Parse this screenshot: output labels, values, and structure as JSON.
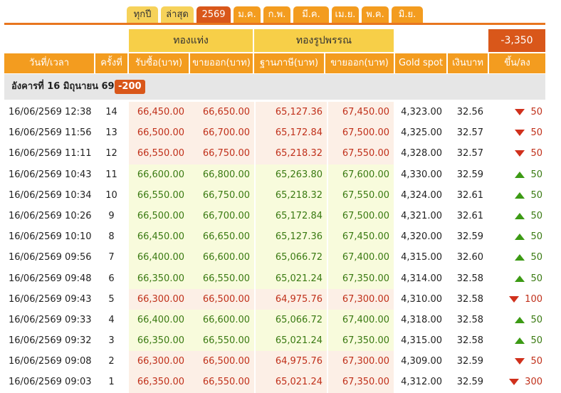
{
  "tabs": [
    {
      "label": "ทุกปี",
      "style": "light"
    },
    {
      "label": "ล่าสุด",
      "style": "light"
    },
    {
      "label": "2569",
      "style": "active"
    },
    {
      "label": "ม.ค.",
      "style": "normal"
    },
    {
      "label": "ก.พ.",
      "style": "normal"
    },
    {
      "label": "มี.ค.",
      "style": "normal"
    },
    {
      "label": "เม.ย.",
      "style": "normal"
    },
    {
      "label": "พ.ค.",
      "style": "normal"
    },
    {
      "label": "มิ.ย.",
      "style": "normal"
    }
  ],
  "header": {
    "group_bar": "ทองแท่ง",
    "group_ornament": "ทองรูปพรรณ",
    "total_change": "-3,350",
    "columns": {
      "datetime": "วันที่/เวลา",
      "round": "ครั้งที่",
      "bar_buy": "รับซื้อ(บาท)",
      "bar_sell": "ขายออก(บาท)",
      "orn_base": "ฐานภาษี(บาท)",
      "orn_sell": "ขายออก(บาท)",
      "gold_spot": "Gold spot",
      "thb": "เงินบาท",
      "change": "ขึ้น/ลง"
    }
  },
  "day": {
    "label": "อังคารที่ 16 มิถุนายน 69",
    "change": "-200"
  },
  "colors": {
    "tab_orange": "#f39c1f",
    "tab_active": "#d9571a",
    "group_yellow": "#f7cf48",
    "up_green": "#3c9a14",
    "down_red": "#d0301c"
  },
  "rows": [
    {
      "datetime": "16/06/2569 12:38",
      "round": "14",
      "bar_buy": "66,450.00",
      "bar_sell": "66,650.00",
      "orn_base": "65,127.36",
      "orn_sell": "67,450.00",
      "spot": "4,323.00",
      "thb": "32.56",
      "dir": "down",
      "change": "50"
    },
    {
      "datetime": "16/06/2569 11:56",
      "round": "13",
      "bar_buy": "66,500.00",
      "bar_sell": "66,700.00",
      "orn_base": "65,172.84",
      "orn_sell": "67,500.00",
      "spot": "4,325.00",
      "thb": "32.57",
      "dir": "down",
      "change": "50"
    },
    {
      "datetime": "16/06/2569 11:11",
      "round": "12",
      "bar_buy": "66,550.00",
      "bar_sell": "66,750.00",
      "orn_base": "65,218.32",
      "orn_sell": "67,550.00",
      "spot": "4,328.00",
      "thb": "32.57",
      "dir": "down",
      "change": "50"
    },
    {
      "datetime": "16/06/2569 10:43",
      "round": "11",
      "bar_buy": "66,600.00",
      "bar_sell": "66,800.00",
      "orn_base": "65,263.80",
      "orn_sell": "67,600.00",
      "spot": "4,330.00",
      "thb": "32.59",
      "dir": "up",
      "change": "50"
    },
    {
      "datetime": "16/06/2569 10:34",
      "round": "10",
      "bar_buy": "66,550.00",
      "bar_sell": "66,750.00",
      "orn_base": "65,218.32",
      "orn_sell": "67,550.00",
      "spot": "4,324.00",
      "thb": "32.61",
      "dir": "up",
      "change": "50"
    },
    {
      "datetime": "16/06/2569 10:26",
      "round": "9",
      "bar_buy": "66,500.00",
      "bar_sell": "66,700.00",
      "orn_base": "65,172.84",
      "orn_sell": "67,500.00",
      "spot": "4,321.00",
      "thb": "32.61",
      "dir": "up",
      "change": "50"
    },
    {
      "datetime": "16/06/2569 10:10",
      "round": "8",
      "bar_buy": "66,450.00",
      "bar_sell": "66,650.00",
      "orn_base": "65,127.36",
      "orn_sell": "67,450.00",
      "spot": "4,320.00",
      "thb": "32.59",
      "dir": "up",
      "change": "50"
    },
    {
      "datetime": "16/06/2569 09:56",
      "round": "7",
      "bar_buy": "66,400.00",
      "bar_sell": "66,600.00",
      "orn_base": "65,066.72",
      "orn_sell": "67,400.00",
      "spot": "4,315.00",
      "thb": "32.60",
      "dir": "up",
      "change": "50"
    },
    {
      "datetime": "16/06/2569 09:48",
      "round": "6",
      "bar_buy": "66,350.00",
      "bar_sell": "66,550.00",
      "orn_base": "65,021.24",
      "orn_sell": "67,350.00",
      "spot": "4,314.00",
      "thb": "32.58",
      "dir": "up",
      "change": "50"
    },
    {
      "datetime": "16/06/2569 09:43",
      "round": "5",
      "bar_buy": "66,300.00",
      "bar_sell": "66,500.00",
      "orn_base": "64,975.76",
      "orn_sell": "67,300.00",
      "spot": "4,310.00",
      "thb": "32.58",
      "dir": "down",
      "change": "100"
    },
    {
      "datetime": "16/06/2569 09:33",
      "round": "4",
      "bar_buy": "66,400.00",
      "bar_sell": "66,600.00",
      "orn_base": "65,066.72",
      "orn_sell": "67,400.00",
      "spot": "4,318.00",
      "thb": "32.58",
      "dir": "up",
      "change": "50"
    },
    {
      "datetime": "16/06/2569 09:32",
      "round": "3",
      "bar_buy": "66,350.00",
      "bar_sell": "66,550.00",
      "orn_base": "65,021.24",
      "orn_sell": "67,350.00",
      "spot": "4,315.00",
      "thb": "32.58",
      "dir": "up",
      "change": "50"
    },
    {
      "datetime": "16/06/2569 09:08",
      "round": "2",
      "bar_buy": "66,300.00",
      "bar_sell": "66,500.00",
      "orn_base": "64,975.76",
      "orn_sell": "67,300.00",
      "spot": "4,309.00",
      "thb": "32.59",
      "dir": "down",
      "change": "50"
    },
    {
      "datetime": "16/06/2569 09:03",
      "round": "1",
      "bar_buy": "66,350.00",
      "bar_sell": "66,550.00",
      "orn_base": "65,021.24",
      "orn_sell": "67,350.00",
      "spot": "4,312.00",
      "thb": "32.59",
      "dir": "down",
      "change": "300"
    }
  ]
}
